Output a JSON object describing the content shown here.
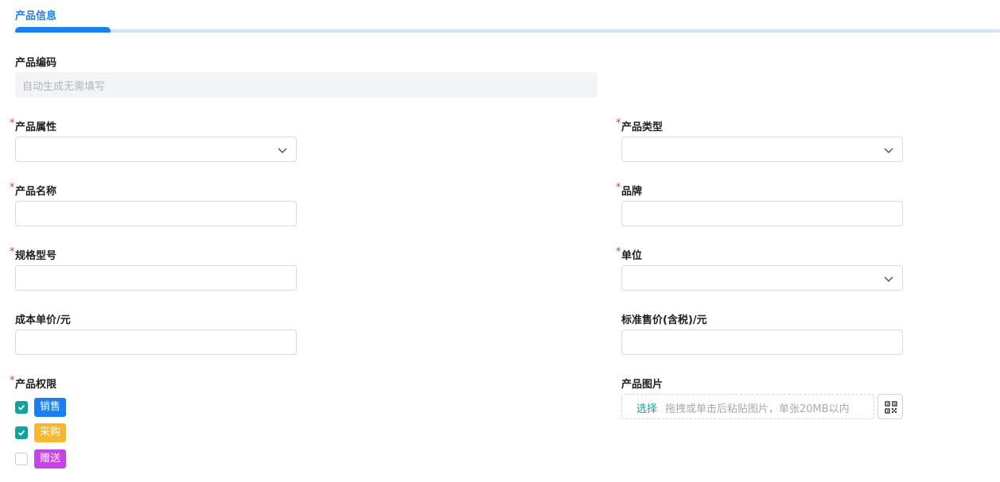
{
  "tab": {
    "title": "产品信息"
  },
  "fields": {
    "code": {
      "label": "产品编码",
      "value": "自动生成无需填写"
    },
    "attribute": {
      "label": "产品属性",
      "required": "*"
    },
    "category": {
      "label": "产品类型",
      "required": "*"
    },
    "name": {
      "label": "产品名称",
      "required": "*"
    },
    "brand": {
      "label": "品牌",
      "required": "*"
    },
    "spec": {
      "label": "规格型号",
      "required": "*"
    },
    "unit": {
      "label": "单位",
      "required": "*"
    },
    "cost_price": {
      "label": "成本单价/元"
    },
    "sale_price": {
      "label": "标准售价(含税)/元"
    },
    "permission": {
      "label": "产品权限",
      "required": "*"
    },
    "image": {
      "label": "产品图片",
      "select_label": "选择",
      "hint": "拖拽或单击后粘贴图片，单张20MB以内"
    }
  },
  "permissions": [
    {
      "label": "销售",
      "checked": true,
      "color": "#1a7ff0"
    },
    {
      "label": "采购",
      "checked": true,
      "color": "#f5b82e"
    },
    {
      "label": "赠送",
      "checked": false,
      "color": "#c643e6"
    }
  ],
  "colors": {
    "accent": "#1a7ff0",
    "required": "#e23b3b",
    "check": "#13a39a"
  },
  "icons": {
    "dropdown": "chevron-down-icon",
    "checkbox": "check-icon",
    "qr": "qr-code-icon"
  }
}
